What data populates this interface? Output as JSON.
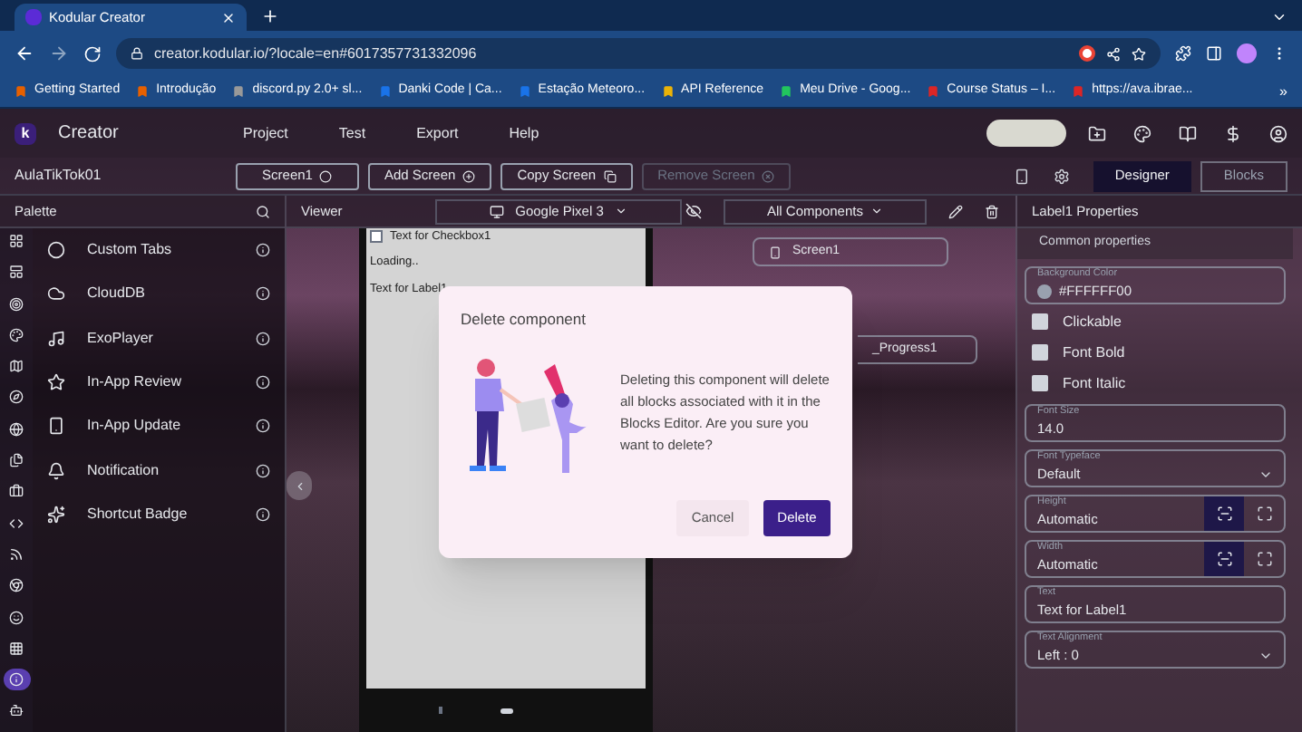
{
  "browser": {
    "tab_title": "Kodular Creator",
    "url": "creator.kodular.io/?locale=en#6017357731332096",
    "bookmarks": [
      "Getting Started",
      "Introdução",
      "discord.py 2.0+ sl...",
      "Danki Code | Ca...",
      "Estação Meteoro...",
      "API Reference",
      "Meu Drive - Goog...",
      "Course Status – I...",
      "https://ava.ibrae..."
    ],
    "more": "»"
  },
  "app": {
    "logo": "k",
    "title": "Creator",
    "menu": [
      "Project",
      "Test",
      "Export",
      "Help"
    ]
  },
  "toolbar": {
    "project": "AulaTikTok01",
    "buttons": [
      {
        "label": "Screen1",
        "disabled": false
      },
      {
        "label": "Add Screen",
        "disabled": false
      },
      {
        "label": "Copy Screen",
        "disabled": false
      },
      {
        "label": "Remove Screen",
        "disabled": true
      }
    ],
    "modes": [
      {
        "label": "Designer",
        "selected": true
      },
      {
        "label": "Blocks",
        "selected": false
      }
    ]
  },
  "palette": {
    "title": "Palette",
    "rail": [
      {
        "selected": false
      },
      {
        "selected": false
      },
      {
        "selected": false
      },
      {
        "selected": false
      },
      {
        "selected": false
      },
      {
        "selected": false
      },
      {
        "selected": false
      },
      {
        "selected": false
      },
      {
        "selected": false
      },
      {
        "selected": false
      },
      {
        "selected": false
      },
      {
        "selected": false
      },
      {
        "selected": false
      },
      {
        "selected": false
      },
      {
        "selected": true
      },
      {
        "selected": false
      }
    ],
    "items": [
      "Custom Tabs",
      "CloudDB",
      "ExoPlayer",
      "In-App Review",
      "In-App Update",
      "Notification",
      "Shortcut Badge"
    ]
  },
  "viewer": {
    "title": "Viewer",
    "device": "Google Pixel 3",
    "phone": {
      "checkbox": "Text for Checkbox1",
      "checked": false,
      "lines": [
        "Loading..",
        "Text for Label1"
      ]
    }
  },
  "components": {
    "filter": "All Components",
    "tree": [
      "Screen1",
      "_Progress1"
    ]
  },
  "properties": {
    "title": "Label1 Properties",
    "section": "Common properties",
    "fields": [
      {
        "kind": "color",
        "label": "Background Color",
        "value": "#FFFFFF00"
      },
      {
        "kind": "checkbox",
        "label": "Clickable",
        "checked": false
      },
      {
        "kind": "checkbox",
        "label": "Font Bold",
        "checked": false
      },
      {
        "kind": "checkbox",
        "label": "Font Italic",
        "checked": false
      },
      {
        "kind": "text",
        "label": "Font Size",
        "value": "14.0"
      },
      {
        "kind": "select",
        "label": "Font Typeface",
        "value": "Default"
      },
      {
        "kind": "size",
        "label": "Height",
        "value": "Automatic",
        "automatic": true
      },
      {
        "kind": "size",
        "label": "Width",
        "value": "Automatic",
        "automatic": true
      },
      {
        "kind": "text",
        "label": "Text",
        "value": "Text for Label1"
      },
      {
        "kind": "select",
        "label": "Text Alignment",
        "value": "Left : 0"
      }
    ]
  },
  "dialog": {
    "title": "Delete component",
    "message": "Deleting this component will delete all blocks associated with it in the Blocks Editor. Are you sure you want to delete?",
    "buttons": [
      {
        "label": "Cancel",
        "primary": false
      },
      {
        "label": "Delete",
        "primary": true
      }
    ]
  }
}
